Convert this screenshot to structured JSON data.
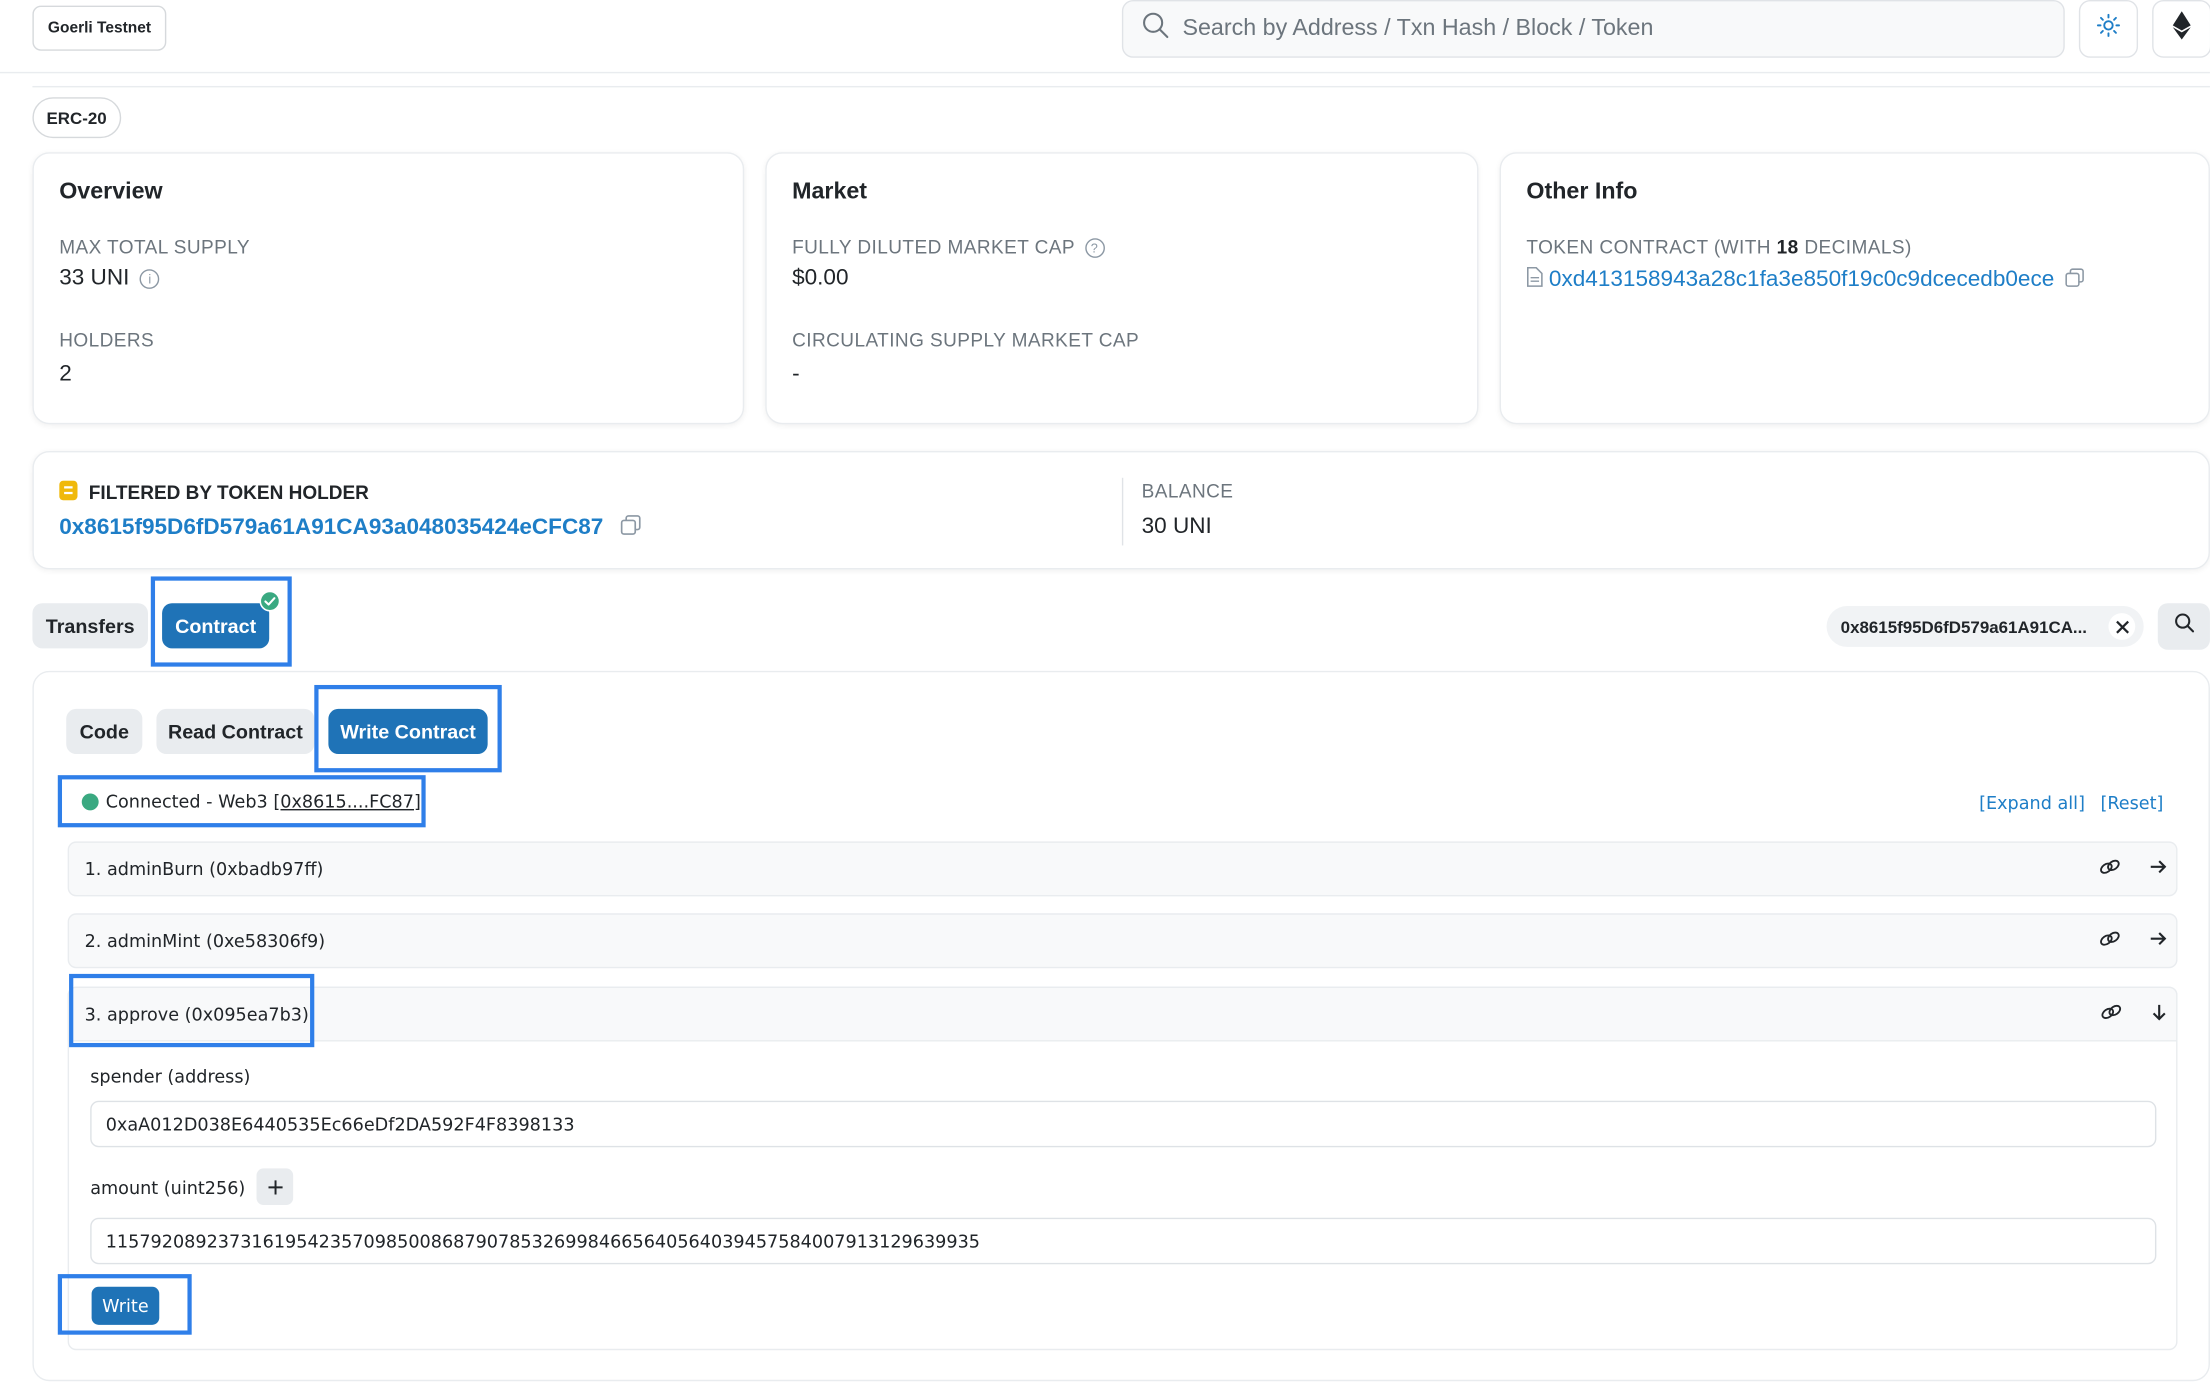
{
  "header": {
    "network": "Goerli Testnet",
    "search_placeholder": "Search by Address / Txn Hash / Block / Token"
  },
  "token_type": "ERC-20",
  "overview": {
    "title": "Overview",
    "max_supply_label": "MAX TOTAL SUPPLY",
    "max_supply_value": "33 UNI",
    "holders_label": "HOLDERS",
    "holders_value": "2"
  },
  "market": {
    "title": "Market",
    "fdmc_label": "FULLY DILUTED MARKET CAP",
    "fdmc_value": "$0.00",
    "csmc_label": "CIRCULATING SUPPLY MARKET CAP",
    "csmc_value": "-"
  },
  "other_info": {
    "title": "Other Info",
    "contract_label_prefix": "TOKEN CONTRACT (WITH ",
    "decimals": "18",
    "contract_label_suffix": " DECIMALS)",
    "contract_address": "0xd413158943a28c1fa3e850f19c0c9dcecedb0ece"
  },
  "holder_filter": {
    "label": "FILTERED BY TOKEN HOLDER",
    "address": "0x8615f95D6fD579a61A91CA93a048035424eCFC87",
    "balance_label": "BALANCE",
    "balance_value": "30 UNI"
  },
  "tabs": {
    "transfers": "Transfers",
    "contract": "Contract"
  },
  "filter_chip": "0x8615f95D6fD579a61A91CA...",
  "contract_tabs": {
    "code": "Code",
    "read": "Read Contract",
    "write": "Write Contract"
  },
  "connection": {
    "status": "Connected - Web3 ",
    "address": "[0x8615....FC87]"
  },
  "actions": {
    "expand_all": "[Expand all]",
    "reset": "[Reset]"
  },
  "functions": [
    {
      "label": "1. adminBurn (0xbadb97ff)"
    },
    {
      "label": "2. adminMint (0xe58306f9)"
    },
    {
      "label": "3. approve (0x095ea7b3)"
    }
  ],
  "approve_form": {
    "spender_label": "spender (address)",
    "spender_value": "0xaA012D038E6440535Ec66eDf2DA592F4F8398133",
    "amount_label": "amount (uint256)",
    "amount_value": "115792089237316195423570985008687907853269984665640564039457584007913129639935",
    "write_label": "Write"
  },
  "colors": {
    "accent": "#1f73b7",
    "link": "#1e7ec7",
    "highlight": "#2f7fe9",
    "connected": "#3aa981"
  }
}
